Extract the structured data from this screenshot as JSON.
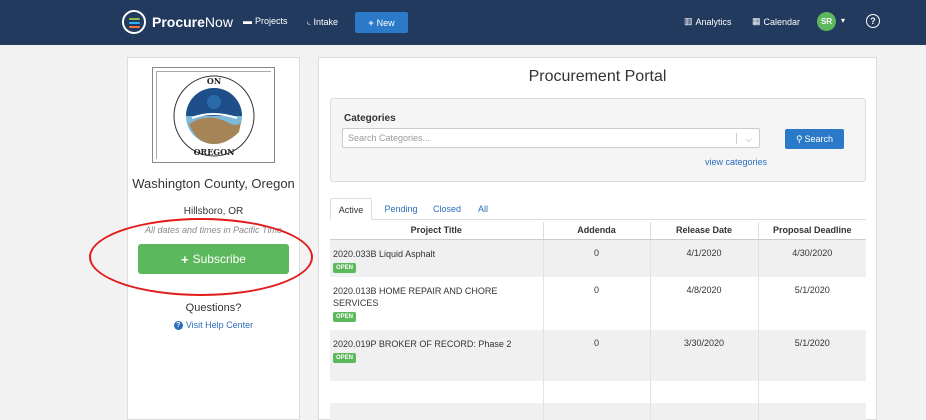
{
  "nav": {
    "brand_bold": "Procure",
    "brand_light": "Now",
    "projects": "Projects",
    "intake": "Intake",
    "new": "New",
    "analytics": "Analytics",
    "calendar": "Calendar",
    "avatar_initials": "SR",
    "help": "?"
  },
  "org": {
    "name": "Washington County, Oregon",
    "location": "Hillsboro, OR",
    "timezone_note": "All dates and times in Pacific Time",
    "subscribe": "Subscribe",
    "questions": "Questions?",
    "help_center": "Visit Help Center"
  },
  "portal": {
    "title": "Procurement Portal",
    "categories_label": "Categories",
    "search_placeholder": "Search Categories...",
    "search_button": "Search",
    "view_categories": "view categories",
    "tabs": [
      "Active",
      "Pending",
      "Closed",
      "All"
    ],
    "columns": [
      "Project Title",
      "Addenda",
      "Release Date",
      "Proposal Deadline"
    ],
    "rows": [
      {
        "title": "2020.033B Liquid Asphalt",
        "status": "OPEN",
        "addenda": "0",
        "release": "4/1/2020",
        "deadline": "4/30/2020"
      },
      {
        "title": "2020.013B HOME REPAIR AND CHORE SERVICES",
        "status": "OPEN",
        "addenda": "0",
        "release": "4/8/2020",
        "deadline": "5/1/2020"
      },
      {
        "title": "2020.019P BROKER OF RECORD: Phase 2",
        "status": "OPEN",
        "addenda": "0",
        "release": "3/30/2020",
        "deadline": "5/1/2020"
      }
    ]
  },
  "colors": {
    "navbar": "#223a5e",
    "primary": "#2a7ac9",
    "success": "#5cb85c",
    "annotation": "#e21b1b"
  }
}
